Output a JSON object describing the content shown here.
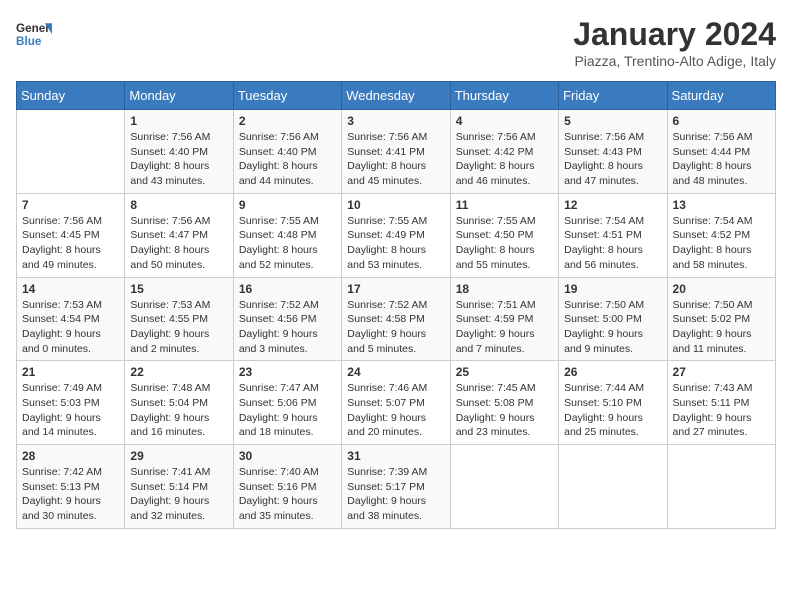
{
  "logo": {
    "line1": "General",
    "line2": "Blue"
  },
  "title": "January 2024",
  "location": "Piazza, Trentino-Alto Adige, Italy",
  "weekdays": [
    "Sunday",
    "Monday",
    "Tuesday",
    "Wednesday",
    "Thursday",
    "Friday",
    "Saturday"
  ],
  "weeks": [
    [
      {
        "day": "",
        "info": ""
      },
      {
        "day": "1",
        "info": "Sunrise: 7:56 AM\nSunset: 4:40 PM\nDaylight: 8 hours\nand 43 minutes."
      },
      {
        "day": "2",
        "info": "Sunrise: 7:56 AM\nSunset: 4:40 PM\nDaylight: 8 hours\nand 44 minutes."
      },
      {
        "day": "3",
        "info": "Sunrise: 7:56 AM\nSunset: 4:41 PM\nDaylight: 8 hours\nand 45 minutes."
      },
      {
        "day": "4",
        "info": "Sunrise: 7:56 AM\nSunset: 4:42 PM\nDaylight: 8 hours\nand 46 minutes."
      },
      {
        "day": "5",
        "info": "Sunrise: 7:56 AM\nSunset: 4:43 PM\nDaylight: 8 hours\nand 47 minutes."
      },
      {
        "day": "6",
        "info": "Sunrise: 7:56 AM\nSunset: 4:44 PM\nDaylight: 8 hours\nand 48 minutes."
      }
    ],
    [
      {
        "day": "7",
        "info": "Sunrise: 7:56 AM\nSunset: 4:45 PM\nDaylight: 8 hours\nand 49 minutes."
      },
      {
        "day": "8",
        "info": "Sunrise: 7:56 AM\nSunset: 4:47 PM\nDaylight: 8 hours\nand 50 minutes."
      },
      {
        "day": "9",
        "info": "Sunrise: 7:55 AM\nSunset: 4:48 PM\nDaylight: 8 hours\nand 52 minutes."
      },
      {
        "day": "10",
        "info": "Sunrise: 7:55 AM\nSunset: 4:49 PM\nDaylight: 8 hours\nand 53 minutes."
      },
      {
        "day": "11",
        "info": "Sunrise: 7:55 AM\nSunset: 4:50 PM\nDaylight: 8 hours\nand 55 minutes."
      },
      {
        "day": "12",
        "info": "Sunrise: 7:54 AM\nSunset: 4:51 PM\nDaylight: 8 hours\nand 56 minutes."
      },
      {
        "day": "13",
        "info": "Sunrise: 7:54 AM\nSunset: 4:52 PM\nDaylight: 8 hours\nand 58 minutes."
      }
    ],
    [
      {
        "day": "14",
        "info": "Sunrise: 7:53 AM\nSunset: 4:54 PM\nDaylight: 9 hours\nand 0 minutes."
      },
      {
        "day": "15",
        "info": "Sunrise: 7:53 AM\nSunset: 4:55 PM\nDaylight: 9 hours\nand 2 minutes."
      },
      {
        "day": "16",
        "info": "Sunrise: 7:52 AM\nSunset: 4:56 PM\nDaylight: 9 hours\nand 3 minutes."
      },
      {
        "day": "17",
        "info": "Sunrise: 7:52 AM\nSunset: 4:58 PM\nDaylight: 9 hours\nand 5 minutes."
      },
      {
        "day": "18",
        "info": "Sunrise: 7:51 AM\nSunset: 4:59 PM\nDaylight: 9 hours\nand 7 minutes."
      },
      {
        "day": "19",
        "info": "Sunrise: 7:50 AM\nSunset: 5:00 PM\nDaylight: 9 hours\nand 9 minutes."
      },
      {
        "day": "20",
        "info": "Sunrise: 7:50 AM\nSunset: 5:02 PM\nDaylight: 9 hours\nand 11 minutes."
      }
    ],
    [
      {
        "day": "21",
        "info": "Sunrise: 7:49 AM\nSunset: 5:03 PM\nDaylight: 9 hours\nand 14 minutes."
      },
      {
        "day": "22",
        "info": "Sunrise: 7:48 AM\nSunset: 5:04 PM\nDaylight: 9 hours\nand 16 minutes."
      },
      {
        "day": "23",
        "info": "Sunrise: 7:47 AM\nSunset: 5:06 PM\nDaylight: 9 hours\nand 18 minutes."
      },
      {
        "day": "24",
        "info": "Sunrise: 7:46 AM\nSunset: 5:07 PM\nDaylight: 9 hours\nand 20 minutes."
      },
      {
        "day": "25",
        "info": "Sunrise: 7:45 AM\nSunset: 5:08 PM\nDaylight: 9 hours\nand 23 minutes."
      },
      {
        "day": "26",
        "info": "Sunrise: 7:44 AM\nSunset: 5:10 PM\nDaylight: 9 hours\nand 25 minutes."
      },
      {
        "day": "27",
        "info": "Sunrise: 7:43 AM\nSunset: 5:11 PM\nDaylight: 9 hours\nand 27 minutes."
      }
    ],
    [
      {
        "day": "28",
        "info": "Sunrise: 7:42 AM\nSunset: 5:13 PM\nDaylight: 9 hours\nand 30 minutes."
      },
      {
        "day": "29",
        "info": "Sunrise: 7:41 AM\nSunset: 5:14 PM\nDaylight: 9 hours\nand 32 minutes."
      },
      {
        "day": "30",
        "info": "Sunrise: 7:40 AM\nSunset: 5:16 PM\nDaylight: 9 hours\nand 35 minutes."
      },
      {
        "day": "31",
        "info": "Sunrise: 7:39 AM\nSunset: 5:17 PM\nDaylight: 9 hours\nand 38 minutes."
      },
      {
        "day": "",
        "info": ""
      },
      {
        "day": "",
        "info": ""
      },
      {
        "day": "",
        "info": ""
      }
    ]
  ]
}
